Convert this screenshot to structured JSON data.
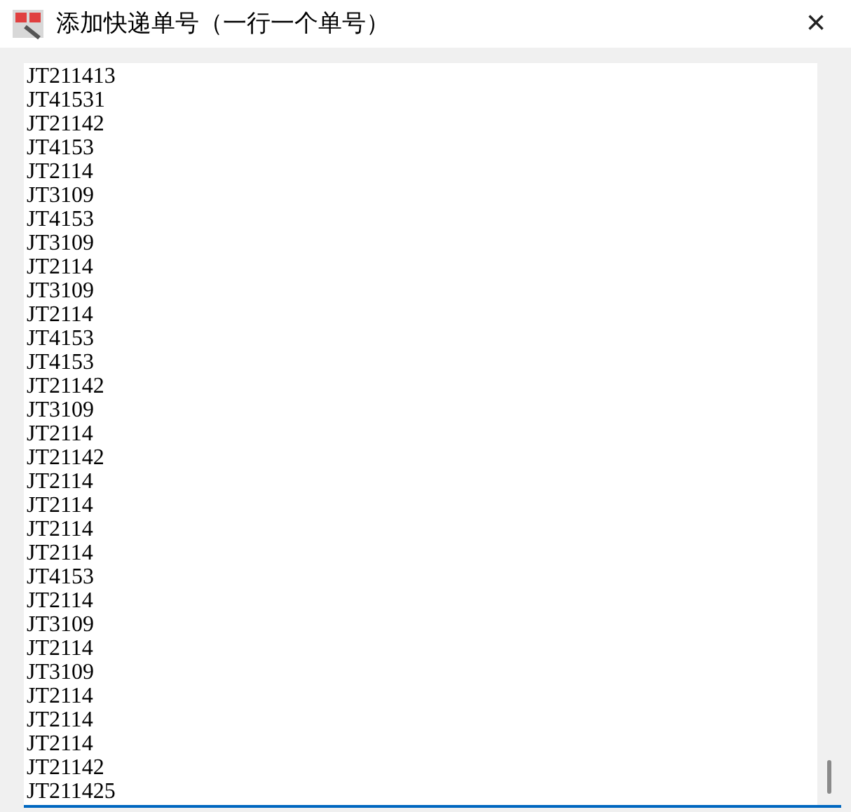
{
  "window": {
    "title": "添加快递单号（一行一个单号）",
    "close": "×"
  },
  "text_area": {
    "focused": true,
    "lines": [
      "JT211413",
      "JT41531",
      "JT21142",
      "JT4153",
      "JT2114",
      "JT3109",
      "JT4153",
      "JT3109",
      "JT2114",
      "JT3109",
      "JT2114",
      "JT4153",
      "JT4153",
      "JT21142",
      "JT3109",
      "JT2114",
      "JT21142",
      "JT2114",
      "JT2114",
      "JT2114",
      "JT2114",
      "JT4153",
      "JT2114",
      "JT3109",
      "JT2114",
      "JT3109",
      "JT2114",
      "JT2114",
      "JT2114",
      "JT21142",
      "JT211425"
    ]
  }
}
